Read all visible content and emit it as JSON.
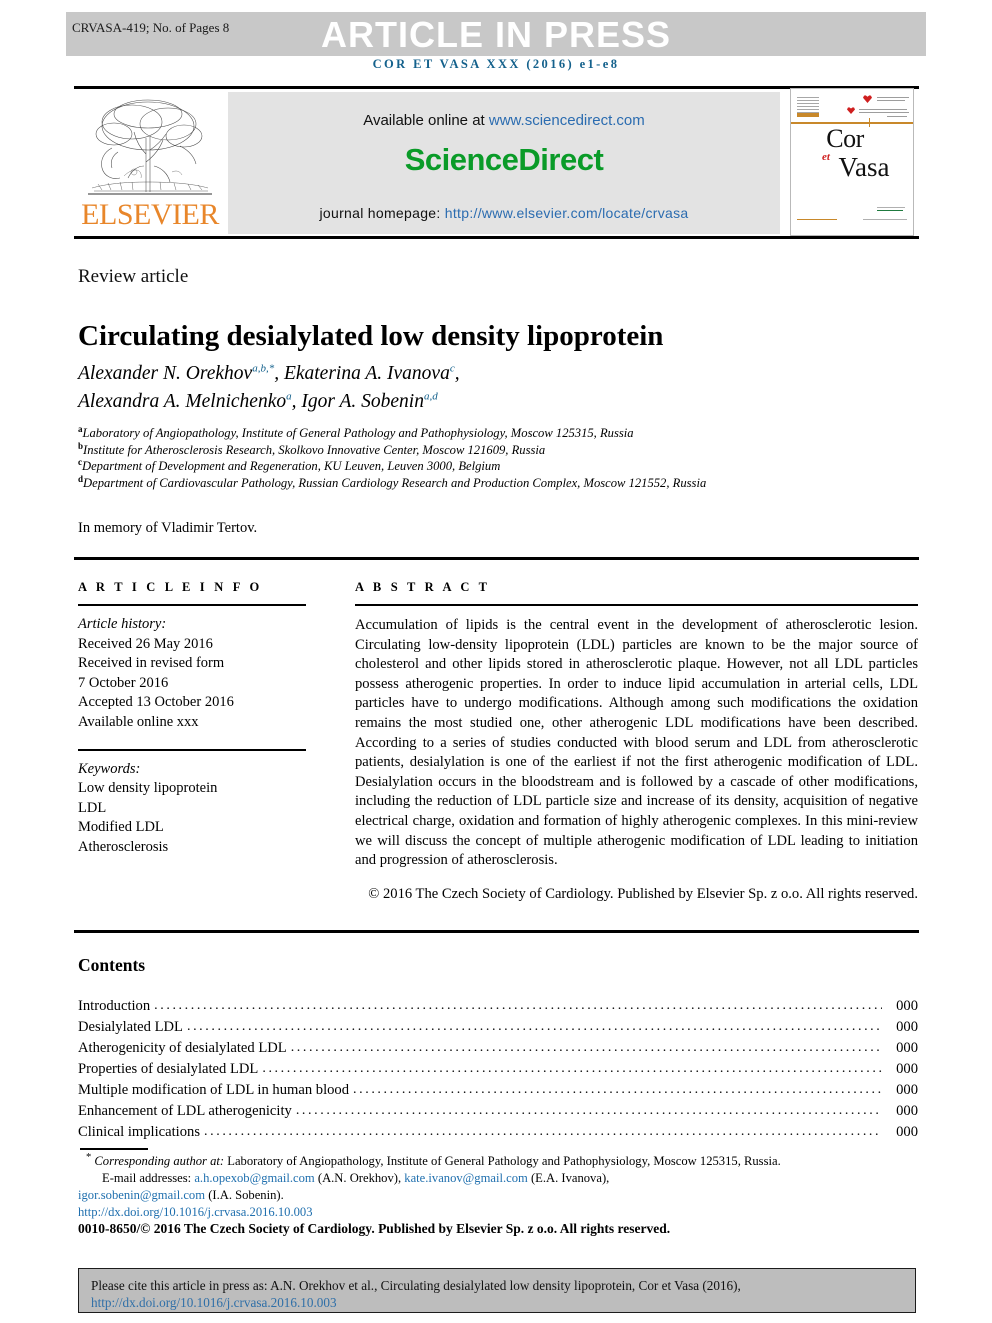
{
  "header": {
    "manuscript_id": "CRVASA-419; No. of Pages 8",
    "banner": "ARTICLE IN PRESS",
    "journal_citation_line": "COR ET VASA XXX (2016) e1-e8"
  },
  "masthead": {
    "publisher_name": "ELSEVIER",
    "available_online_label": "Available online at",
    "sciencedirect_url": "www.sciencedirect.com",
    "sciencedirect_logo": "ScienceDirect",
    "homepage_label": "journal homepage:",
    "homepage_url": "http://www.elsevier.com/locate/crvasa",
    "cover_title_line1": "Cor",
    "cover_title_et": "et",
    "cover_title_line2": "Vasa"
  },
  "article": {
    "type_label": "Review article",
    "title": "Circulating desialylated low density lipoprotein",
    "authors_line1_a": "Alexander N. Orekhov",
    "authors_line1_a_sup": "a,b,*",
    "authors_line1_b": ", Ekaterina A. Ivanova",
    "authors_line1_b_sup": "c",
    "authors_line1_end": ",",
    "authors_line2_a": "Alexandra A. Melnichenko",
    "authors_line2_a_sup": "a",
    "authors_line2_b": ", Igor A. Sobenin",
    "authors_line2_b_sup": "a,d",
    "affiliations": [
      {
        "marker": "a",
        "text": "Laboratory of Angiopathology, Institute of General Pathology and Pathophysiology, Moscow 125315, Russia"
      },
      {
        "marker": "b",
        "text": "Institute for Atherosclerosis Research, Skolkovo Innovative Center, Moscow 121609, Russia"
      },
      {
        "marker": "c",
        "text": "Department of Development and Regeneration, KU Leuven, Leuven 3000, Belgium"
      },
      {
        "marker": "d",
        "text": "Department of Cardiovascular Pathology, Russian Cardiology Research and Production Complex, Moscow 121552, Russia"
      }
    ],
    "dedication": "In memory of Vladimir Tertov."
  },
  "article_info": {
    "heading": "A R T I C L E   I N F O",
    "history_label": "Article history:",
    "history": [
      "Received 26 May 2016",
      "Received in revised form",
      "7 October 2016",
      "Accepted 13 October 2016",
      "Available online xxx"
    ],
    "keywords_label": "Keywords:",
    "keywords": [
      "Low density lipoprotein",
      "LDL",
      "Modified LDL",
      "Atherosclerosis"
    ]
  },
  "abstract": {
    "heading": "A B S T R A C T",
    "body": "Accumulation of lipids is the central event in the development of atherosclerotic lesion. Circulating low-density lipoprotein (LDL) particles are known to be the major source of cholesterol and other lipids stored in atherosclerotic plaque. However, not all LDL particles possess atherogenic properties. In order to induce lipid accumulation in arterial cells, LDL particles have to undergo modifications. Although among such modifications the oxidation remains the most studied one, other atherogenic LDL modifications have been described. According to a series of studies conducted with blood serum and LDL from atherosclerotic patients, desialylation is one of the earliest if not the first atherogenic modification of LDL. Desialylation occurs in the bloodstream and is followed by a cascade of other modifications, including the reduction of LDL particle size and increase of its density, acquisition of negative electrical charge, oxidation and formation of highly atherogenic complexes. In this mini-review we will discuss the concept of multiple atherogenic modification of LDL leading to initiation and progression of atherosclerosis.",
    "copyright": "© 2016 The Czech Society of Cardiology. Published by Elsevier Sp. z o.o. All rights reserved."
  },
  "contents": {
    "heading": "Contents",
    "entries": [
      {
        "label": "Introduction",
        "page": "000"
      },
      {
        "label": "Desialylated LDL",
        "page": "000"
      },
      {
        "label": "Atherogenicity of desialylated LDL",
        "page": "000"
      },
      {
        "label": "Properties of desialylated LDL",
        "page": "000"
      },
      {
        "label": "Multiple modification of LDL in human blood",
        "page": "000"
      },
      {
        "label": "Enhancement of LDL atherogenicity",
        "page": "000"
      },
      {
        "label": "Clinical implications",
        "page": "000"
      }
    ],
    "dot_fill": "......................................................................................................................................................................."
  },
  "footnotes": {
    "corresponding_marker": "*",
    "corresponding_label": "Corresponding author at:",
    "corresponding_text": "Laboratory of Angiopathology, Institute of General Pathology and Pathophysiology, Moscow 125315, Russia.",
    "email_label": "E-mail addresses:",
    "emails": [
      {
        "address": "a.h.opexob@gmail.com",
        "owner": "(A.N. Orekhov),"
      },
      {
        "address": "kate.ivanov@gmail.com",
        "owner": "(E.A. Ivanova),"
      },
      {
        "address": "igor.sobenin@gmail.com",
        "owner": "(I.A. Sobenin)."
      }
    ],
    "doi": "http://dx.doi.org/10.1016/j.crvasa.2016.10.003",
    "issn_line": "0010-8650/© 2016 The Czech Society of Cardiology. Published by Elsevier Sp. z o.o. All rights reserved."
  },
  "citation_box": {
    "text": "Please cite this article in press as: A.N. Orekhov et al., Circulating desialylated low density lipoprotein, Cor et Vasa (2016), ",
    "link_part1": "http://dx.doi.org/",
    "link_part2": "10.1016/j.crvasa.2016.10.003"
  },
  "colors": {
    "banner_bg": "#c8c8c8",
    "link_blue": "#1f6fae",
    "journal_blue": "#14618c",
    "sciencedirect_green": "#0a9b28",
    "elsevier_orange": "#e8862a",
    "cite_box_bg": "#bdbdbd"
  }
}
